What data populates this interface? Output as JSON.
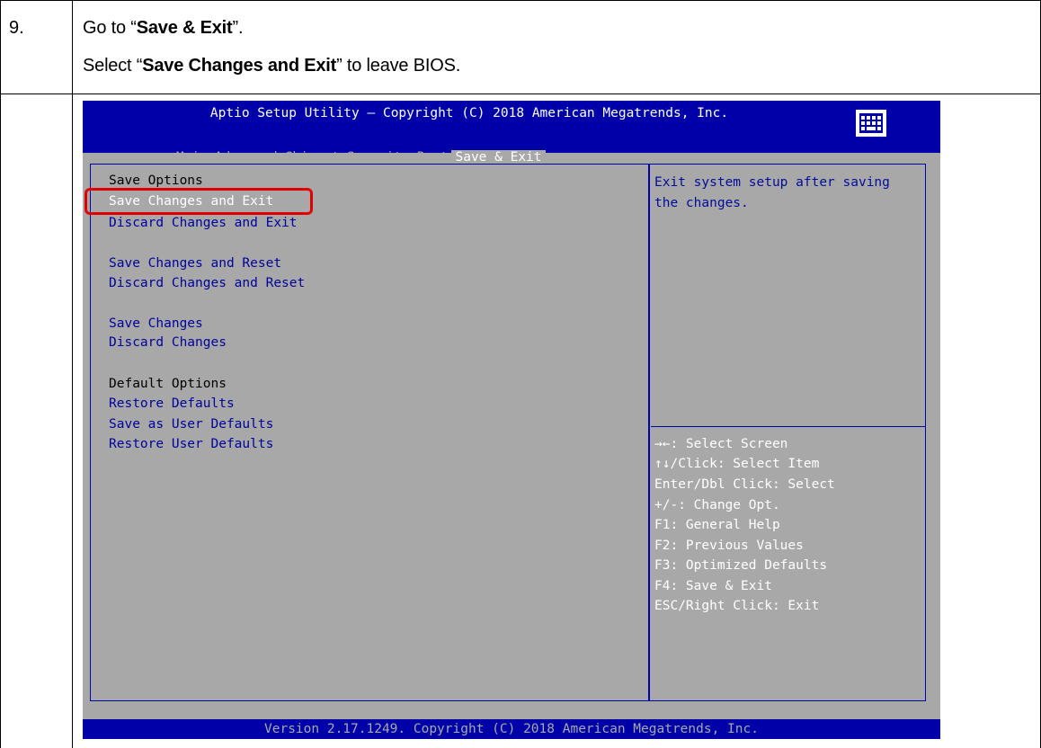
{
  "step": {
    "number": "9.",
    "line1_prefix": "Go to “",
    "line1_bold": "Save & Exit",
    "line1_suffix": "”.",
    "line2_prefix": "Select “",
    "line2_bold": "Save Changes and Exit",
    "line2_suffix": "” to leave BIOS."
  },
  "bios": {
    "title": "Aptio Setup Utility – Copyright (C) 2018 American Megatrends, Inc.",
    "tabs": [
      "Main",
      "Advanced",
      "Chipset",
      "Security",
      "Boot",
      "Save & Exit"
    ],
    "active_tab": "Save & Exit",
    "menu": {
      "save_options_label": "Save Options",
      "save_changes_and_exit": "Save Changes and Exit",
      "discard_changes_and_exit": "Discard Changes and Exit",
      "save_changes_and_reset": "Save Changes and Reset",
      "discard_changes_and_reset": "Discard Changes and Reset",
      "save_changes": "Save Changes",
      "discard_changes": "Discard Changes",
      "default_options_label": "Default Options",
      "restore_defaults": "Restore Defaults",
      "save_as_user_defaults": "Save as User Defaults",
      "restore_user_defaults": "Restore User Defaults"
    },
    "help": {
      "line1": "Exit system setup after saving",
      "line2": "the changes."
    },
    "key_help": [
      "→←: Select Screen",
      "↑↓/Click: Select Item",
      "Enter/Dbl Click: Select",
      "+/-: Change Opt.",
      "F1: General Help",
      "F2: Previous Values",
      "F3: Optimized Defaults",
      "F4: Save & Exit",
      "ESC/Right Click: Exit"
    ],
    "footer": "Version 2.17.1249. Copyright (C) 2018 American Megatrends, Inc.",
    "colors": {
      "background": "#a8a8a8",
      "bar": "#0000a8",
      "menu_text": "#00009c",
      "highlight_box": "#e00000"
    }
  }
}
